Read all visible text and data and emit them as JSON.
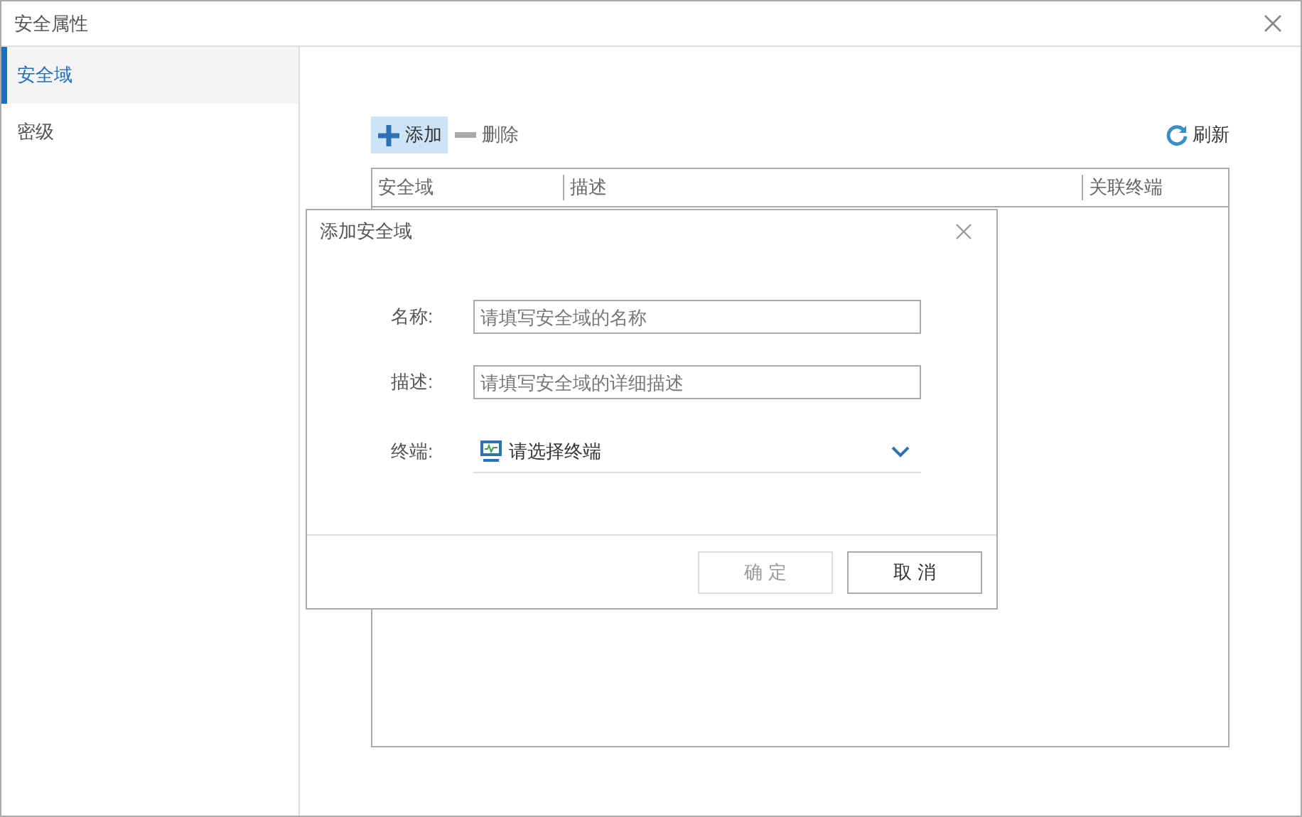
{
  "window": {
    "title": "安全属性"
  },
  "sidebar": {
    "items": [
      {
        "label": "安全域",
        "selected": true
      },
      {
        "label": "密级",
        "selected": false
      }
    ]
  },
  "toolbar": {
    "add": "添加",
    "delete": "删除",
    "refresh": "刷新"
  },
  "table": {
    "columns": [
      "安全域",
      "描述",
      "关联终端"
    ]
  },
  "dialog": {
    "title": "添加安全域",
    "fields": [
      {
        "kind": "text",
        "label": "名称:",
        "placeholder": "请填写安全域的名称"
      },
      {
        "kind": "text",
        "label": "描述:",
        "placeholder": "请填写安全域的详细描述"
      },
      {
        "kind": "select",
        "label": "终端:",
        "placeholder": "请选择终端"
      }
    ],
    "buttons": [
      {
        "label": "确 定",
        "disabled": true
      },
      {
        "label": "取 消",
        "disabled": false
      }
    ]
  }
}
